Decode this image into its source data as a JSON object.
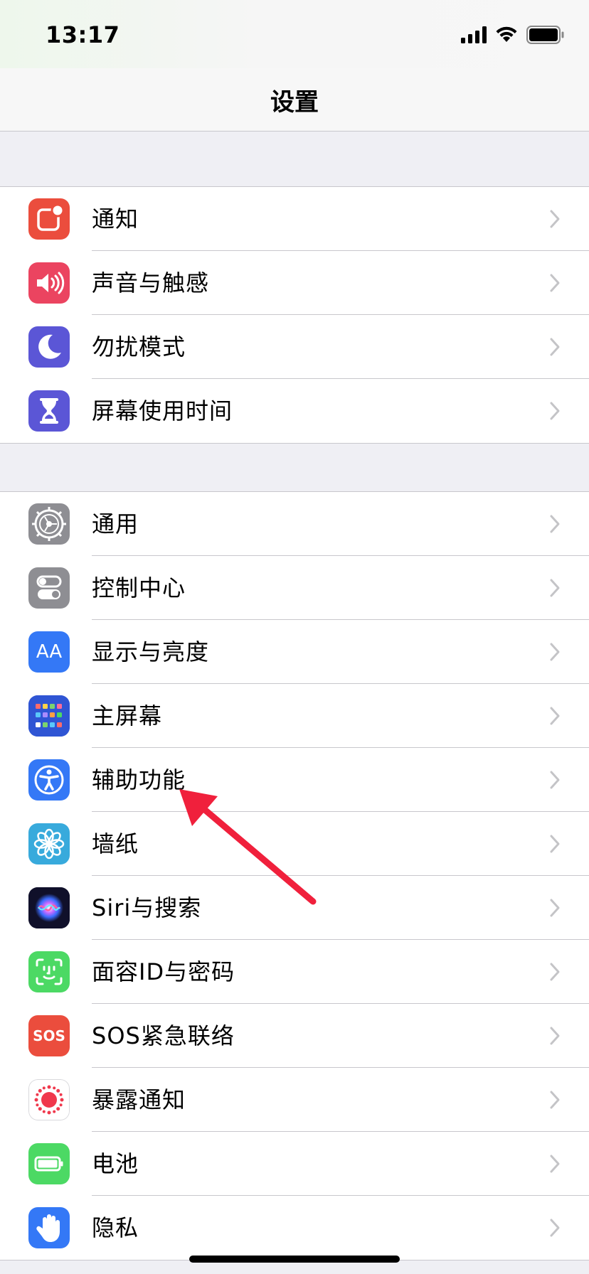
{
  "status_bar": {
    "time": "13:17"
  },
  "nav": {
    "title": "设置"
  },
  "section1": [
    {
      "label": "通知",
      "icon": "notifications-icon",
      "color": "#eb4d3d"
    },
    {
      "label": "声音与触感",
      "icon": "speaker-icon",
      "color": "#eb4460"
    },
    {
      "label": "勿扰模式",
      "icon": "moon-icon",
      "color": "#5b56d6"
    },
    {
      "label": "屏幕使用时间",
      "icon": "hourglass-icon",
      "color": "#5b56d6"
    }
  ],
  "section2": [
    {
      "label": "通用",
      "icon": "gear-icon",
      "color": "#8e8e93"
    },
    {
      "label": "控制中心",
      "icon": "toggles-icon",
      "color": "#8e8e93"
    },
    {
      "label": "显示与亮度",
      "icon": "text-size-icon",
      "color": "#3478f6",
      "icon_text": "AA"
    },
    {
      "label": "主屏幕",
      "icon": "home-grid-icon",
      "color": "#2f55d4"
    },
    {
      "label": "辅助功能",
      "icon": "accessibility-icon",
      "color": "#3478f6"
    },
    {
      "label": "墙纸",
      "icon": "flower-icon",
      "color": "#38aadc"
    },
    {
      "label": "Siri与搜索",
      "icon": "siri-icon",
      "color": "#1c1c3a"
    },
    {
      "label": "面容ID与密码",
      "icon": "face-id-icon",
      "color": "#4cd964"
    },
    {
      "label": "SOS紧急联络",
      "icon": "sos-icon",
      "color": "#eb4d3d",
      "icon_text": "SOS"
    },
    {
      "label": "暴露通知",
      "icon": "exposure-icon",
      "color": "#ffffff"
    },
    {
      "label": "电池",
      "icon": "battery-icon",
      "color": "#4cd964"
    },
    {
      "label": "隐私",
      "icon": "hand-icon",
      "color": "#3478f6"
    }
  ],
  "colors": {
    "chevron": "#c4c4c7",
    "separator": "#c8c7cc",
    "background": "#efeff4",
    "annotation_arrow": "#f0203c"
  }
}
